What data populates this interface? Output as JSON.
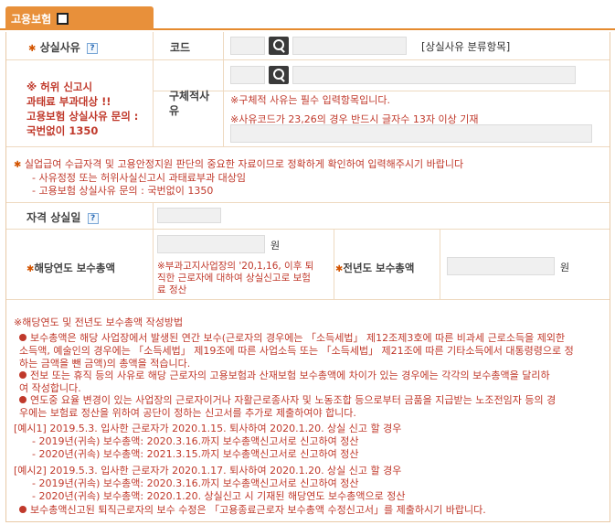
{
  "tab": {
    "label": "고용보험"
  },
  "loss_reason": {
    "label": "상실사유",
    "help": "?",
    "code_label": "코드",
    "category_link": "[상실사유 분류항목]",
    "detail_label_line1": "구체적사",
    "detail_label_line2": "유",
    "detail_required_note": "※구체적 사유는 필수 입력항목입니다.",
    "detail_length_note": "※사유코드가 23,26의 경우 반드시 글자수 13자 이상 기재"
  },
  "warning": {
    "line1": "※ 허위 신고시",
    "line2": "과태료 부과대상 !!",
    "line3": "고용보험 상실사유 문의 :",
    "line4": "국번없이 1350"
  },
  "notice": {
    "line1": "실업급여 수급자격 및 고용안정지원 판단의 중요한 자료이므로 정확하게 확인하여 입력해주시기 바랍니다",
    "line2": "- 사유정정 또는 허위사실신고시 과태료부과 대상임",
    "line3": "- 고용보험 상실사유 문의 : 국번없이 1350"
  },
  "loss_date": {
    "label": "자격 상실일",
    "help": "?"
  },
  "wages": {
    "current_label": "해당연도 보수총액",
    "unit": "원",
    "note_line1": "※부과고지사업장의 '20,1,16, 이후 퇴",
    "note_line2": "직한 근로자에 대하여 상실신고로 보험",
    "note_line3": "료 정산",
    "prev_label": "전년도 보수총액",
    "prev_unit": "원"
  },
  "guide": {
    "title": "※해당연도 및 전년도 보수총액 작성방법",
    "b1_l1": "보수총액은 해당 사업장에서 발생된 연간 보수(근로자의 경우에는 「소득세법」 제12조제3호에 따른 비과세 근로소득을 제외한",
    "b1_l2": "소득액, 예술인의 경우에는 「소득세법」 제19조에 따른 사업소득 또는 「소득세법」 제21조에 따른 기타소득에서 대통령령으로 정",
    "b1_l3": "하는 금액을 뺀 금액)의 총액을 적습니다.",
    "b2_l1": "전보 또는 휴직 등의 사유로 해당 근로자의 고용보험과 산재보험 보수총액에 차이가 있는 경우에는 각각의 보수총액을 달리하",
    "b2_l2": "여 작성합니다.",
    "b3_l1": "연도중 요율 변경이 있는 사업장의 근로자이거나 자활근로종사자 및 노동조합 등으로부터 금품을 지급받는 노조전임자 등의 경",
    "b3_l2": "우에는 보험료 정산을 위하여 공단이 정하는 신고서를 추가로 제출하여야 합니다.",
    "ex1_title": "[예시1] 2019.5.3. 입사한 근로자가 2020.1.15. 퇴사하여 2020.1.20. 상실 신고 할 경우",
    "ex1_l1": "- 2019년(귀속) 보수총액: 2020.3.16.까지 보수총액신고서로 신고하여 정산",
    "ex1_l2": "- 2020년(귀속) 보수총액: 2021.3.15.까지 보수총액신고서로 신고하여 정산",
    "ex2_title": "[예시2] 2019.5.3. 입사한 근로자가 2020.1.17. 퇴사하여 2020.1.20. 상실 신고 할 경우",
    "ex2_l1": "- 2019년(귀속) 보수총액: 2020.3.16.까지 보수총액신고서로 신고하여 정산",
    "ex2_l2": "- 2020년(귀속) 보수총액: 2020.1.20. 상실신고 시 기재된 해당연도 보수총액으로 정산",
    "b4": "보수총액신고된 퇴직근로자의 보수 수정은 「고용종료근로자 보수총액 수정신고서」를 제출하시기 바랍니다."
  },
  "colors": {
    "accent": "#e8903a",
    "warning": "#c0392b",
    "border": "#eed9c0"
  }
}
